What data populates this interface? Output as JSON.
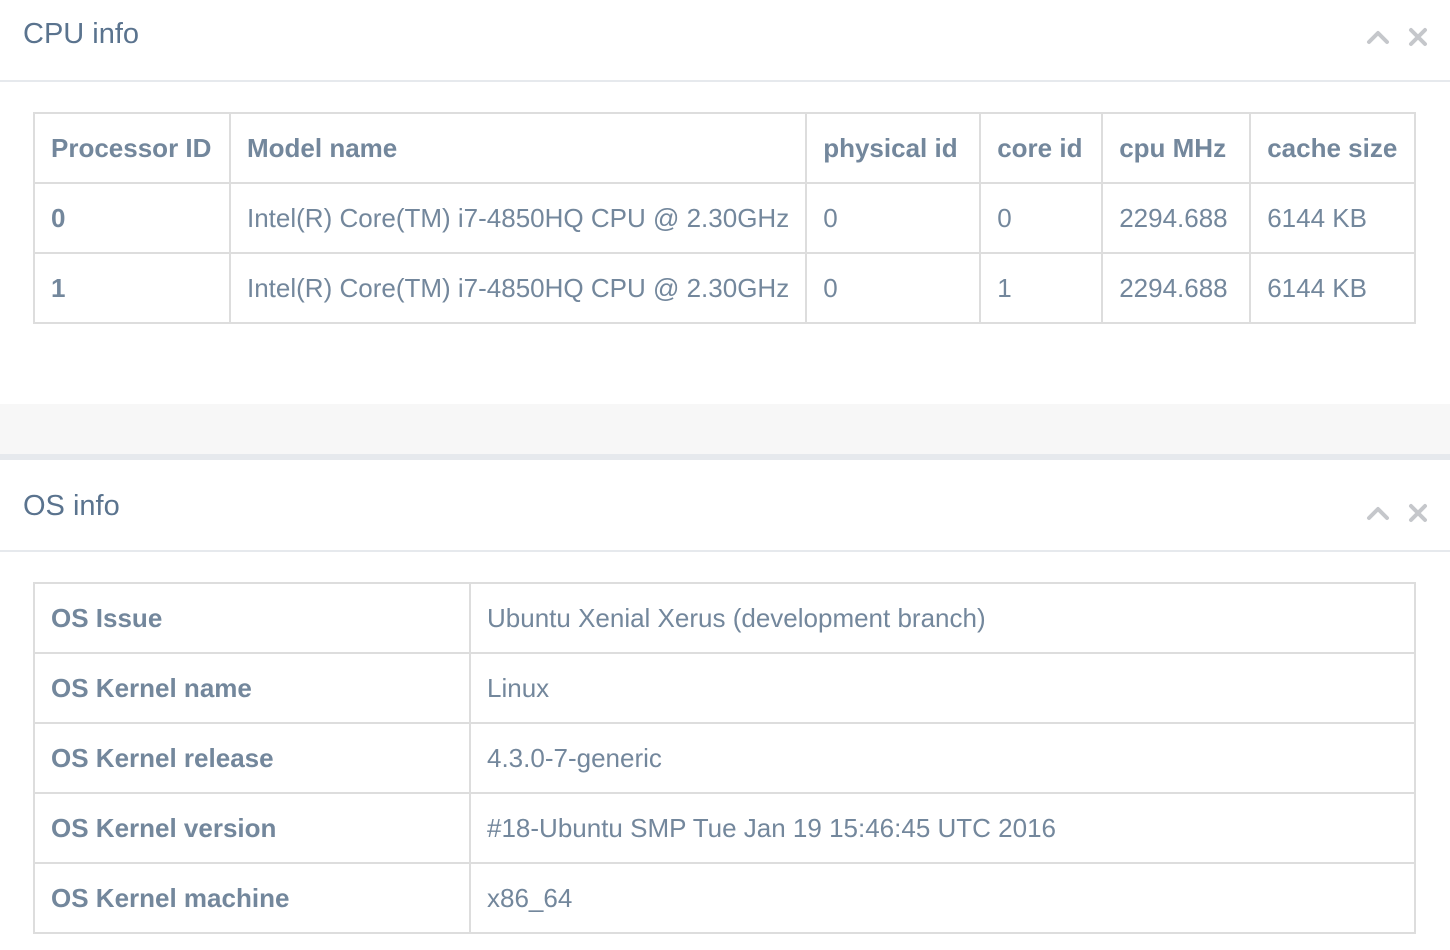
{
  "cpu": {
    "title": "CPU info",
    "columns": [
      "Processor ID",
      "Model name",
      "physical id",
      "core id",
      "cpu MHz",
      "cache size"
    ],
    "rows": [
      [
        "0",
        "Intel(R) Core(TM) i7-4850HQ CPU @ 2.30GHz",
        "0",
        "0",
        "2294.688",
        "6144 KB"
      ],
      [
        "1",
        "Intel(R) Core(TM) i7-4850HQ CPU @ 2.30GHz",
        "0",
        "1",
        "2294.688",
        "6144 KB"
      ]
    ]
  },
  "os": {
    "title": "OS info",
    "rows": [
      [
        "OS Issue",
        "Ubuntu Xenial Xerus (development branch)"
      ],
      [
        "OS Kernel name",
        "Linux"
      ],
      [
        "OS Kernel release",
        "4.3.0-7-generic"
      ],
      [
        "OS Kernel version",
        "#18-Ubuntu SMP Tue Jan 19 15:46:45 UTC 2016"
      ],
      [
        "OS Kernel machine",
        "x86_64"
      ]
    ]
  },
  "icons": {
    "collapse": "chevron-up-icon",
    "close": "close-icon"
  },
  "colors": {
    "title": "#5a738e",
    "text": "#73879c",
    "border": "#dddddd",
    "icon": "#c5c7cb"
  }
}
